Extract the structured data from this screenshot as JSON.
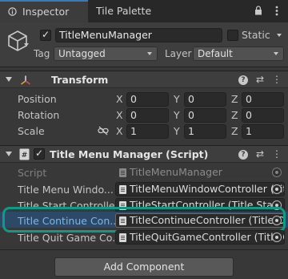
{
  "tabs": {
    "inspector_label": "Inspector",
    "palette_label": "Tile Palette"
  },
  "header": {
    "active_checked": true,
    "name": "TitleMenuManager",
    "static_label": "Static",
    "static_checked": false,
    "tag_label": "Tag",
    "tag_value": "Untagged",
    "layer_label": "Layer",
    "layer_value": "Default"
  },
  "transform": {
    "title": "Transform",
    "position_label": "Position",
    "rotation_label": "Rotation",
    "scale_label": "Scale",
    "axis_x": "X",
    "axis_y": "Y",
    "axis_z": "Z",
    "position": {
      "x": "0",
      "y": "0",
      "z": "0"
    },
    "rotation": {
      "x": "0",
      "y": "0",
      "z": "0"
    },
    "scale": {
      "x": "1",
      "y": "1",
      "z": "1"
    }
  },
  "script_component": {
    "title": "Title Menu Manager (Script)",
    "enabled": true,
    "fields": [
      {
        "label": "Script",
        "value": "TitleMenuManager"
      },
      {
        "label": "Title Menu Windo...",
        "value": "TitleMenuWindowController (Tit"
      },
      {
        "label": "Title Start Controller",
        "value": "TitleStartController (Title Start"
      },
      {
        "label": "Title Continue Con...",
        "value": "TitleContinueController (Title C"
      },
      {
        "label": "Title Quit Game Co...",
        "value": "TitleQuitGameController (Title Q"
      }
    ]
  },
  "add_component_label": "Add Component",
  "colors": {
    "accent_tab": "#3a79bb",
    "highlight_row": "#2c4a68",
    "highlight_outline": "#0f9a87",
    "highlight_label": "#7cb4ee"
  }
}
